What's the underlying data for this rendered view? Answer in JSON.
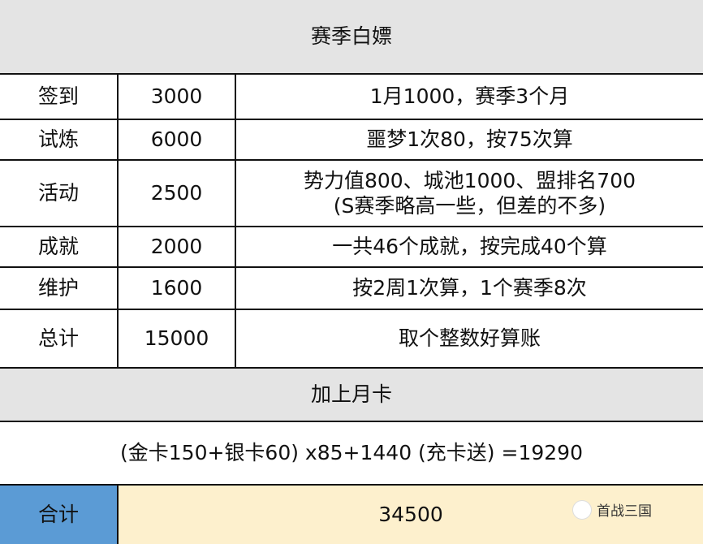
{
  "title": "赛季白嫖",
  "rows": [
    {
      "label": "签到",
      "value": "3000",
      "note": "1月1000，赛季3个月"
    },
    {
      "label": "试炼",
      "value": "6000",
      "note": "噩梦1次80，按75次算"
    },
    {
      "label": "活动",
      "value": "2500",
      "note": "势力值800、城池1000、盟排名700",
      "note2": "(S赛季略高一些，但差的不多)"
    },
    {
      "label": "成就",
      "value": "2000",
      "note": "一共46个成就，按完成40个算"
    },
    {
      "label": "维护",
      "value": "1600",
      "note": "按2周1次算，1个赛季8次"
    },
    {
      "label": "总计",
      "value": "15000",
      "note": "取个整数好算账"
    }
  ],
  "monthly_title": "加上月卡",
  "monthly_formula": "(金卡150+银卡60) x85+1440 (充卡送) =19290",
  "total": {
    "label": "合计",
    "value": "34500"
  },
  "watermark": "首战三国",
  "colors": {
    "header": "#e4e4e4",
    "total_label": "#5b9bd5",
    "total_value": "#fdf0cd"
  }
}
